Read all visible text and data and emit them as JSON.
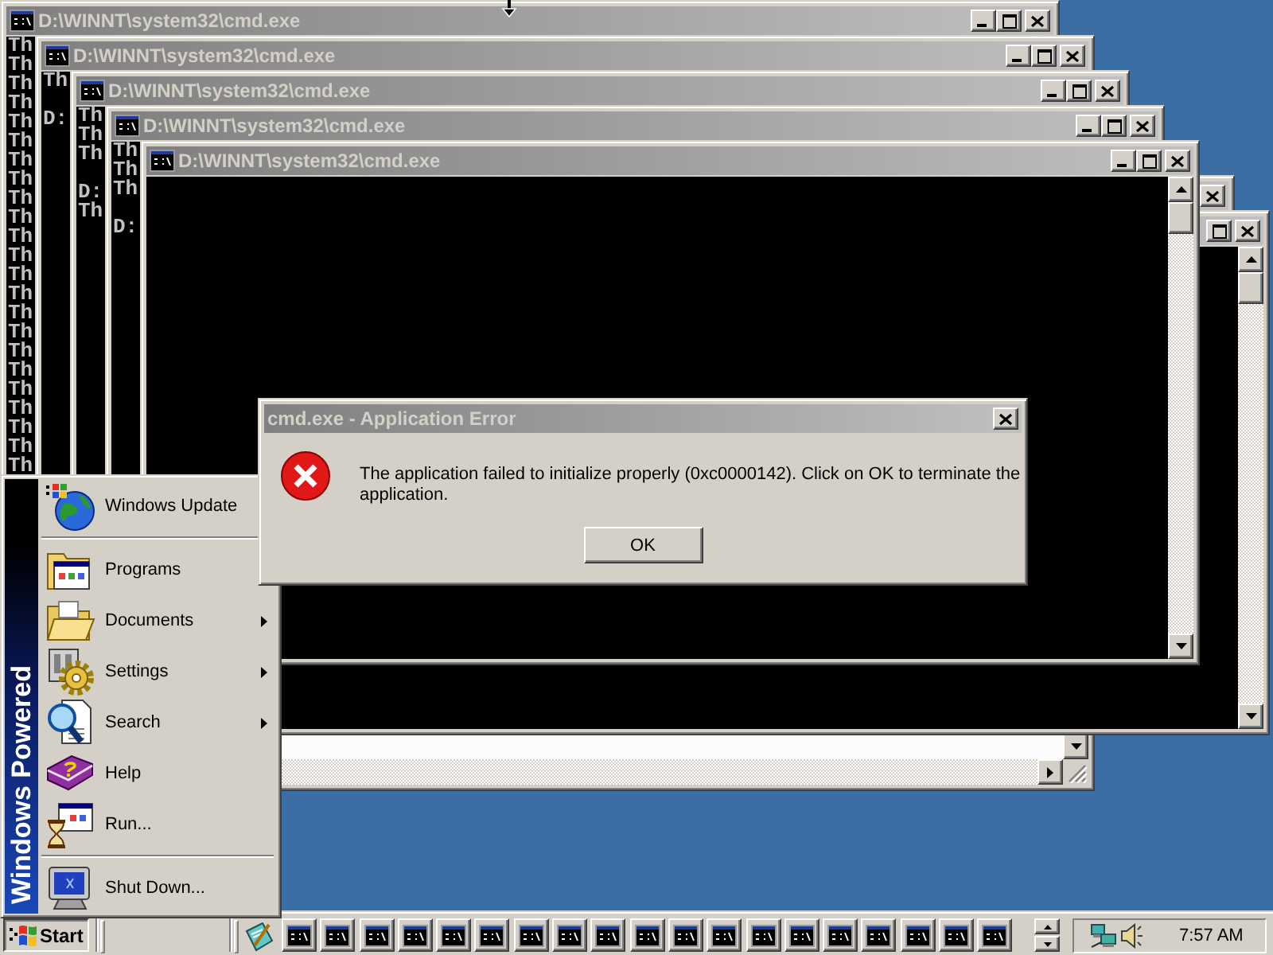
{
  "windows": [
    {
      "title": "D:\\WINNT\\system32\\cmd.exe",
      "buttons": [
        {
          "kind": "minimize"
        },
        {
          "kind": "maximize"
        },
        {
          "kind": "close"
        }
      ],
      "unpainted": false,
      "console_blocks": [
        [
          "Th",
          "Th",
          "Th",
          "Th",
          "Th",
          "Th",
          "Th",
          "Th",
          "Th",
          "Th",
          "Th",
          "Th",
          "Th",
          "Th",
          "Th",
          "Th",
          "Th",
          "Th",
          "Th",
          "Th",
          "Th",
          "Th",
          "Th"
        ]
      ]
    },
    {
      "title": "D:\\WINNT\\system32\\cmd.exe",
      "buttons": [
        {
          "kind": "minimize"
        },
        {
          "kind": "maximize"
        },
        {
          "kind": "close"
        }
      ],
      "unpainted": true,
      "console_blocks": [
        [
          "Th"
        ],
        [
          "D:"
        ]
      ],
      "scrollbars": [
        {
          "kind": "vertical",
          "parts": [
            {
              "kind": "down"
            }
          ]
        },
        {
          "kind": "horizontal",
          "parts": [
            {
              "kind": "right"
            },
            {
              "kind": "grip"
            }
          ]
        }
      ]
    },
    {
      "title": "D:\\WINNT\\system32\\cmd.exe",
      "buttons": [
        {
          "kind": "minimize"
        },
        {
          "kind": "maximize"
        },
        {
          "kind": "close"
        }
      ],
      "unpainted": false,
      "console_blocks": [
        [
          "Th",
          "Th",
          "Th"
        ],
        [
          "D:",
          "Th"
        ]
      ]
    },
    {
      "title": "D:\\WINNT\\system32\\cmd.exe",
      "buttons": [
        {
          "kind": "minimize"
        },
        {
          "kind": "maximize"
        },
        {
          "kind": "close"
        }
      ],
      "unpainted": false,
      "console_blocks": [
        [
          "Th",
          "Th",
          "Th"
        ],
        [
          "D:"
        ]
      ]
    },
    {
      "title": "D:\\WINNT\\system32\\cmd.exe",
      "buttons": [
        {
          "kind": "minimize"
        },
        {
          "kind": "maximize"
        },
        {
          "kind": "close"
        }
      ],
      "unpainted": false,
      "scrollbars": [
        {
          "kind": "vertical",
          "parts": [
            {
              "kind": "up"
            },
            {
              "kind": "thumb"
            },
            {
              "kind": "down"
            }
          ]
        }
      ]
    },
    {
      "buttons": [
        {
          "kind": "close"
        }
      ],
      "unpainted": false
    },
    {
      "buttons": [
        {
          "kind": "maximize"
        },
        {
          "kind": "close"
        }
      ],
      "unpainted": false,
      "scrollbars": [
        {
          "kind": "vertical",
          "parts": [
            {
              "kind": "up"
            },
            {
              "kind": "thumb"
            },
            {
              "kind": "down"
            }
          ]
        }
      ]
    }
  ],
  "start_menu": {
    "banner": "Windows Powered",
    "sections": [
      [
        {
          "label": "Windows Update",
          "submenu": false
        }
      ],
      [
        {
          "label": "Programs",
          "submenu": false
        },
        {
          "label": "Documents",
          "submenu": true
        },
        {
          "label": "Settings",
          "submenu": true
        },
        {
          "label": "Search",
          "submenu": true
        },
        {
          "label": "Help",
          "submenu": false
        },
        {
          "label": "Run...",
          "submenu": false
        }
      ],
      [
        {
          "label": "Shut Down...",
          "submenu": false
        }
      ]
    ]
  },
  "dialog": {
    "title": "cmd.exe - Application Error",
    "message": "The application failed to initialize properly (0xc0000142). Click on OK to terminate the application.",
    "button": "OK"
  },
  "taskbar": {
    "start_button": {
      "label": "Start",
      "pressed": true
    },
    "window_buttons": [
      {
        "selected": false
      },
      {
        "selected": false
      },
      {
        "selected": false
      },
      {
        "selected": false
      },
      {
        "selected": false
      },
      {
        "selected": false
      },
      {
        "selected": false
      },
      {
        "selected": false
      },
      {
        "selected": false
      },
      {
        "selected": false
      },
      {
        "selected": false
      },
      {
        "selected": false
      },
      {
        "selected": false
      },
      {
        "selected": false
      },
      {
        "selected": false
      },
      {
        "selected": false
      },
      {
        "selected": false
      },
      {
        "selected": false
      },
      {
        "selected": false
      }
    ],
    "clock": "7:57 AM"
  }
}
